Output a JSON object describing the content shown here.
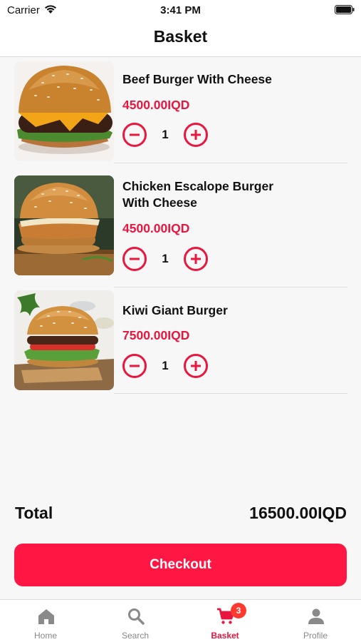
{
  "status_bar": {
    "carrier": "Carrier",
    "time": "3:41 PM"
  },
  "header": {
    "title": "Basket"
  },
  "items": [
    {
      "name": "Beef Burger With Cheese",
      "price": "4500.00IQD",
      "quantity": "1",
      "image": "beef-burger-photo"
    },
    {
      "name": "Chicken Escalope Burger",
      "name_line2": "With Cheese",
      "price": "4500.00IQD",
      "quantity": "1",
      "image": "chicken-burger-photo"
    },
    {
      "name": "Kiwi Giant Burger",
      "price": "7500.00IQD",
      "quantity": "1",
      "image": "kiwi-burger-photo"
    }
  ],
  "total": {
    "label": "Total",
    "value": "16500.00IQD"
  },
  "checkout": {
    "label": "Checkout"
  },
  "tab_bar": {
    "tabs": [
      {
        "label": "Home",
        "icon": "home-icon"
      },
      {
        "label": "Search",
        "icon": "search-icon"
      },
      {
        "label": "Basket",
        "icon": "cart-icon",
        "badge": "3",
        "active": true
      },
      {
        "label": "Profile",
        "icon": "person-icon"
      }
    ]
  },
  "colors": {
    "accent": "#e8173f",
    "button": "#ff1744",
    "badge": "#ff3b30",
    "background": "#f7f7f7"
  }
}
